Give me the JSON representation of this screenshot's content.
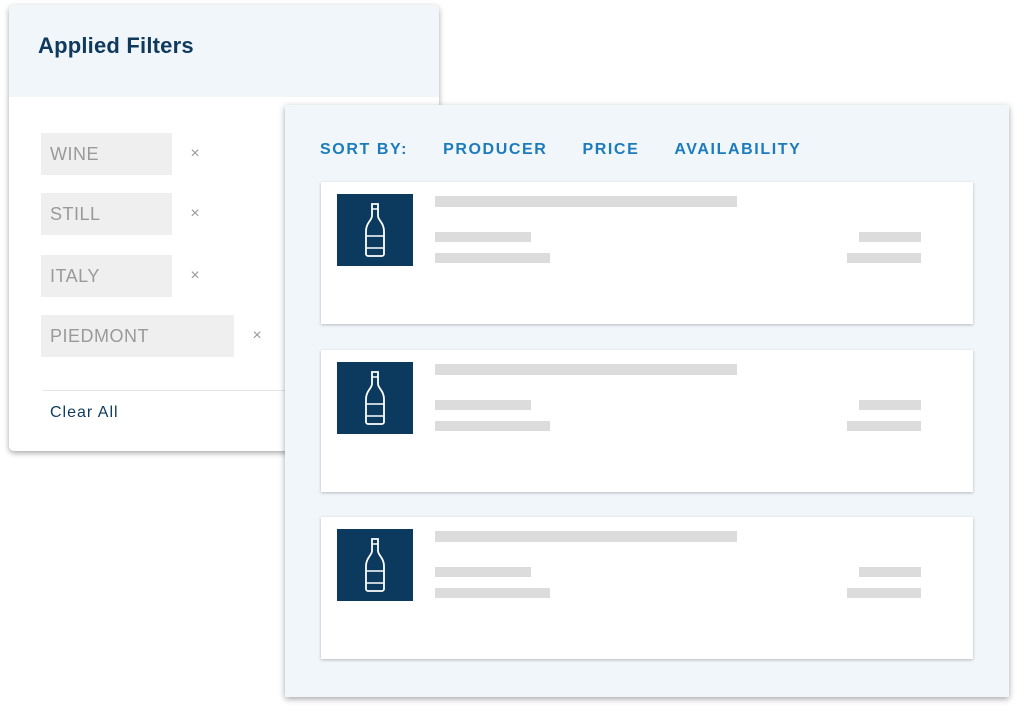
{
  "filters": {
    "title": "Applied Filters",
    "chips": [
      {
        "label": "WINE",
        "remove_glyph": "×"
      },
      {
        "label": "STILL",
        "remove_glyph": "×"
      },
      {
        "label": "ITALY",
        "remove_glyph": "×"
      },
      {
        "label": "PIEDMONT",
        "remove_glyph": "×"
      }
    ],
    "clear_all": "Clear All"
  },
  "sort": {
    "label": "SORT BY:",
    "options": [
      "PRODUCER",
      "PRICE",
      "AVAILABILITY"
    ]
  },
  "results": [
    {
      "thumbnail_icon": "wine-bottle-icon"
    },
    {
      "thumbnail_icon": "wine-bottle-icon"
    },
    {
      "thumbnail_icon": "wine-bottle-icon"
    }
  ],
  "colors": {
    "navy": "#0c3a5f",
    "heading": "#0f3a5e",
    "accent_blue": "#1b7bbd",
    "panel_bg": "#f1f6fa",
    "chip_bg": "#efefef",
    "placeholder_bar": "#dcdcdc"
  }
}
